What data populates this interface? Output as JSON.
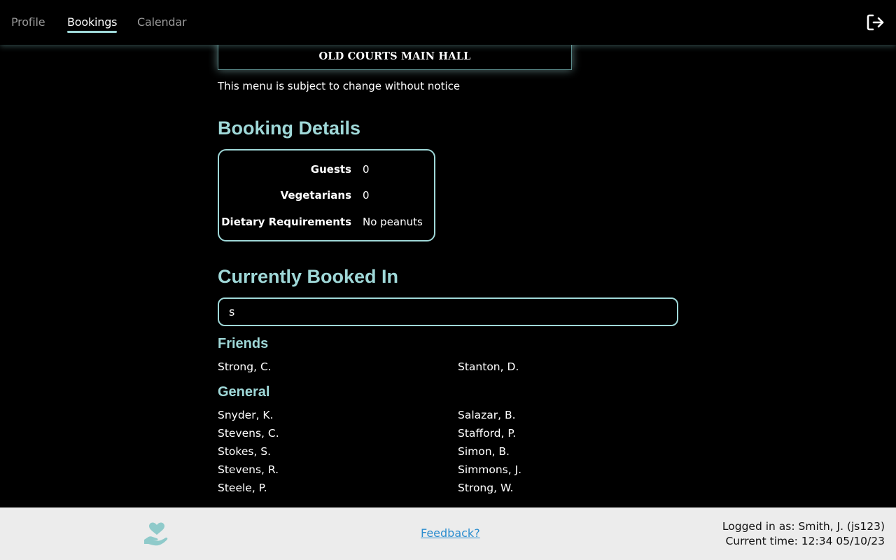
{
  "nav": {
    "tabs": [
      {
        "label": "Profile",
        "active": false
      },
      {
        "label": "Bookings",
        "active": true
      },
      {
        "label": "Calendar",
        "active": false
      }
    ],
    "logout_icon": "logout-icon"
  },
  "banner": {
    "title": "OLD COURTS MAIN HALL"
  },
  "notice": "This menu is subject to change without notice",
  "booking_details": {
    "title": "Booking Details",
    "rows": [
      {
        "label": "Guests",
        "value": "0"
      },
      {
        "label": "Vegetarians",
        "value": "0"
      },
      {
        "label": "Dietary Requirements",
        "value": "No peanuts"
      }
    ]
  },
  "booked_in": {
    "title": "Currently Booked In",
    "search_value": "s",
    "friends": {
      "title": "Friends",
      "names": [
        "Strong, C.",
        "Stanton, D."
      ]
    },
    "general": {
      "title": "General",
      "names": [
        "Snyder, K.",
        "Salazar, B.",
        "Stevens, C.",
        "Stafford, P.",
        "Stokes, S.",
        "Simon, B.",
        "Stevens, R.",
        "Simmons, J.",
        "Steele, P.",
        "Strong, W."
      ]
    }
  },
  "footer": {
    "icon": "hand-heart-icon",
    "feedback_label": "Feedback?",
    "logged_in": "Logged in as: Smith, J. (js123)",
    "current_time": "Current time: 12:34 05/10/23"
  },
  "colors": {
    "accent": "#9fd8d8",
    "background": "#000000",
    "footer_bg": "#ececec",
    "link": "#2c8ecf"
  }
}
